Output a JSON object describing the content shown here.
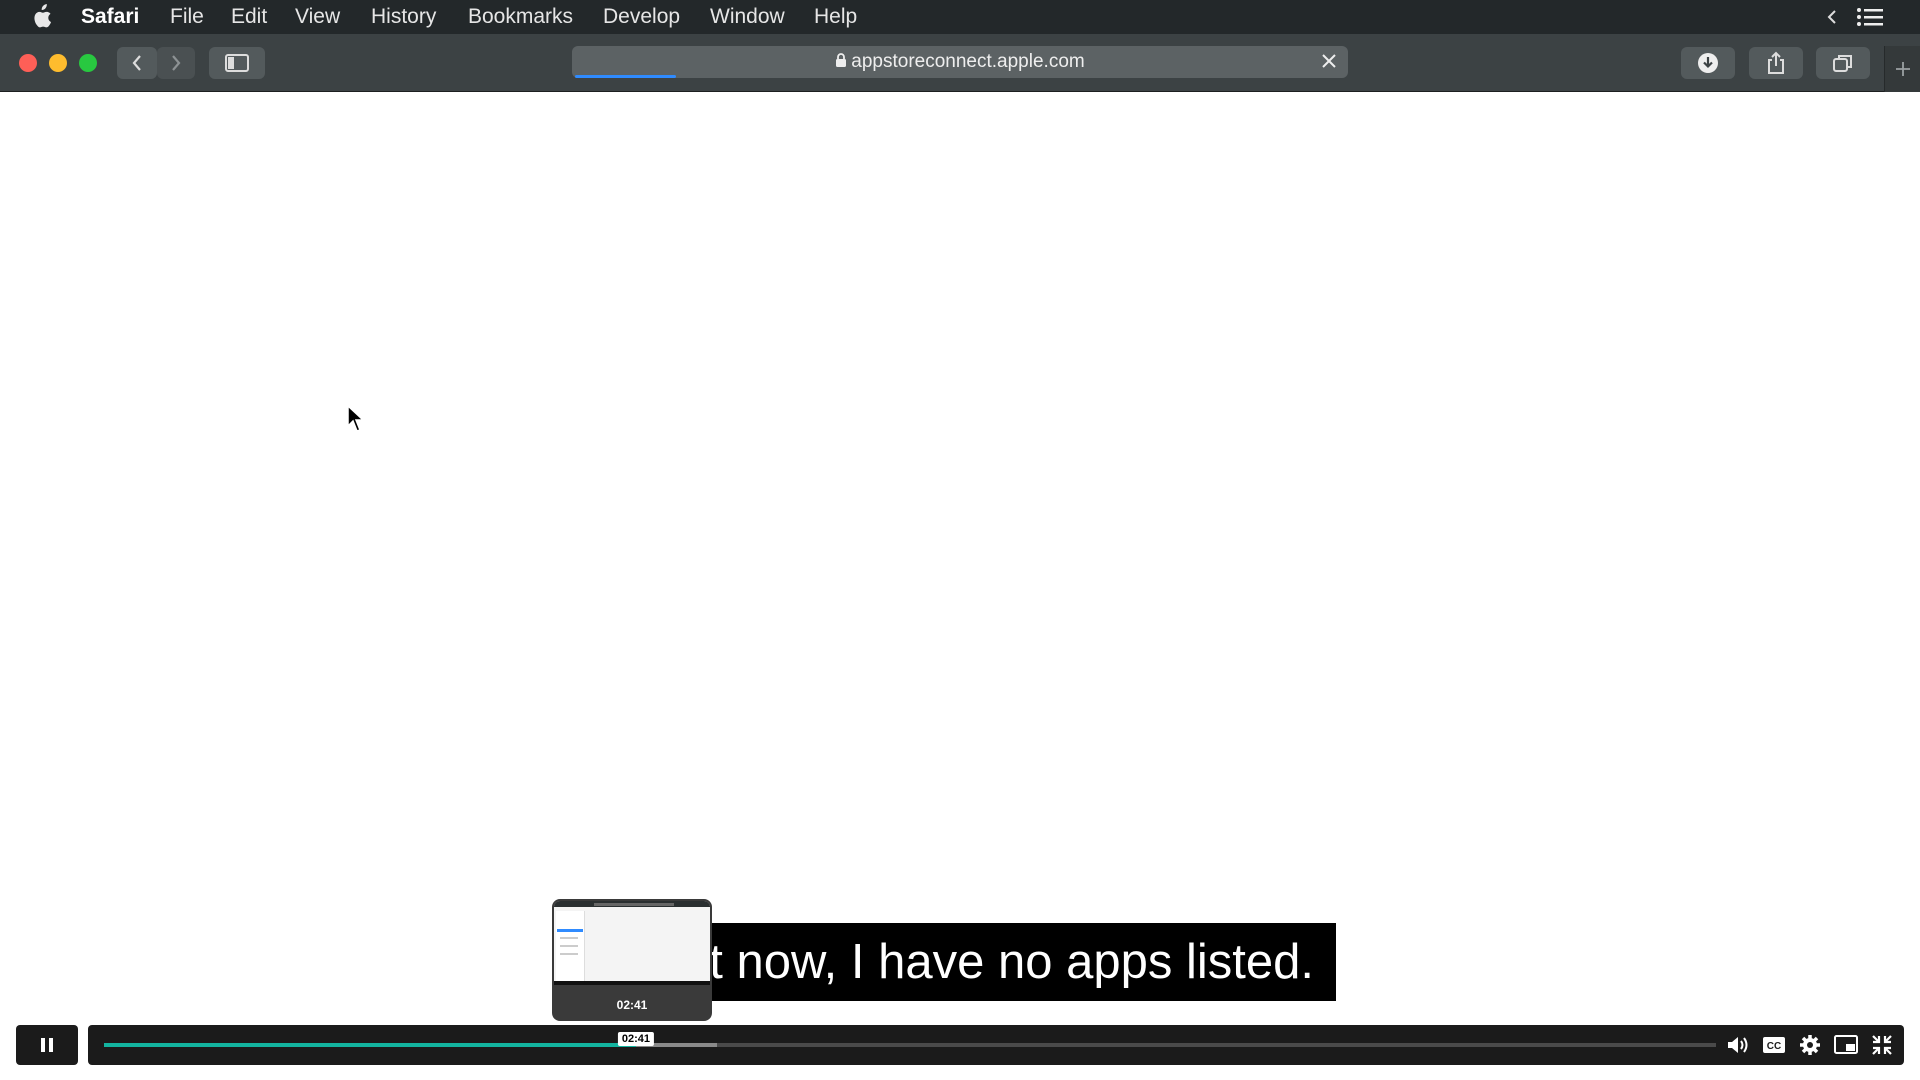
{
  "menubar": {
    "app_name": "Safari",
    "items": [
      "File",
      "Edit",
      "View",
      "History",
      "Bookmarks",
      "Develop",
      "Window",
      "Help"
    ]
  },
  "toolbar": {
    "url": "appstoreconnect.apple.com",
    "page_load_progress": 0.13
  },
  "video": {
    "subtitle": "t now, I have no apps listed.",
    "preview_time": "02:41",
    "hover_time": "02:41",
    "played_fraction": 0.33,
    "buffered_fraction": 0.38,
    "accent_color": "#13b4a0"
  },
  "colors": {
    "close": "#fe5f57",
    "minimize": "#febc2e",
    "zoom": "#28c840"
  }
}
